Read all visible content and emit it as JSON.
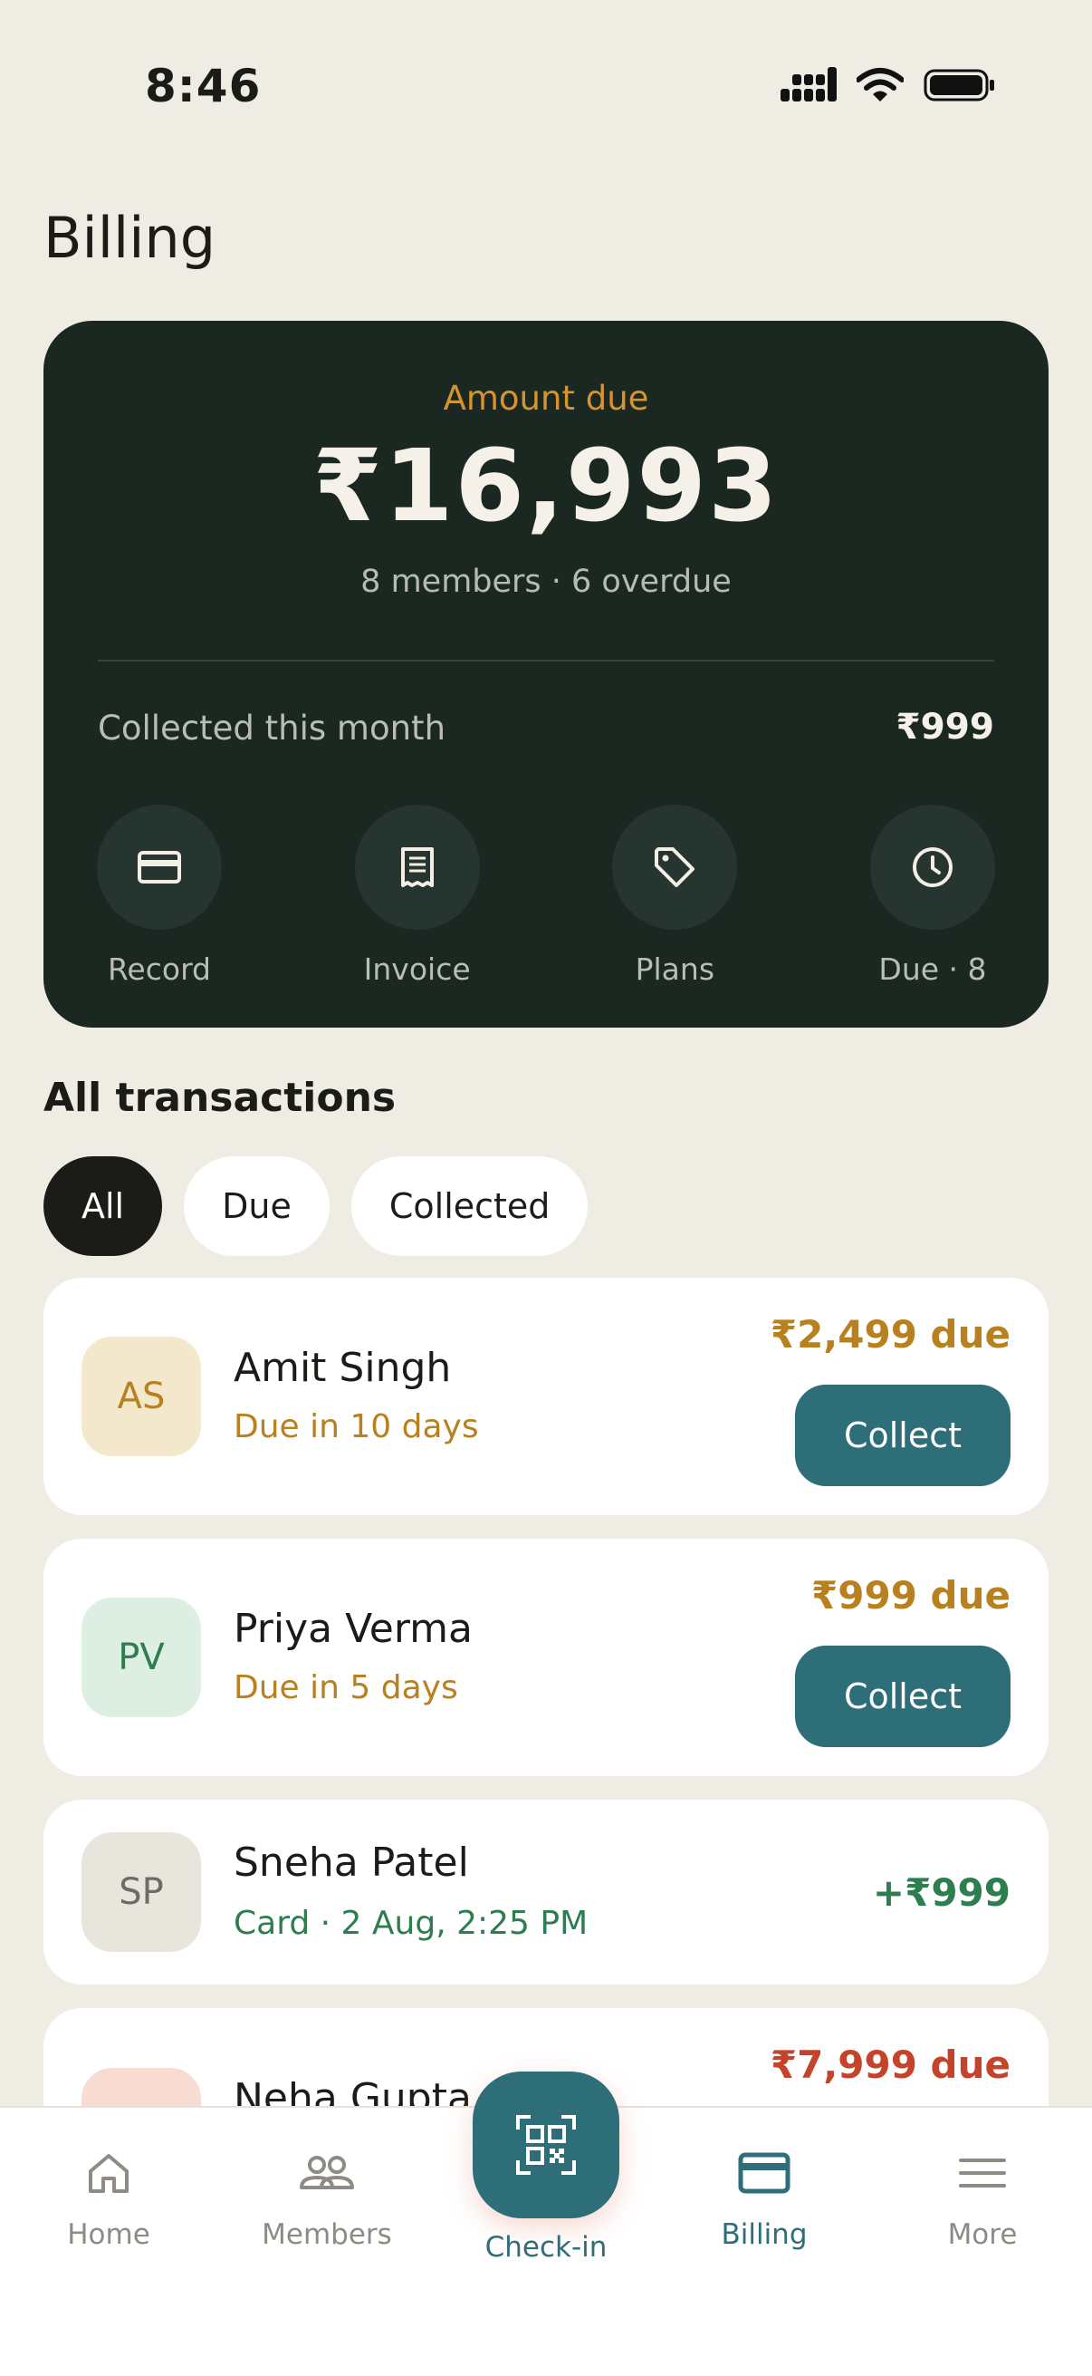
{
  "status_bar": {
    "time": "8:46"
  },
  "page_title": "Billing",
  "summary": {
    "amount_label": "Amount due",
    "amount_value": "₹16,993",
    "amount_sub": "8 members · 6 overdue",
    "collected_label": "Collected this month",
    "collected_value": "₹999",
    "actions": [
      {
        "label": "Record",
        "icon": "card-icon"
      },
      {
        "label": "Invoice",
        "icon": "receipt-icon"
      },
      {
        "label": "Plans",
        "icon": "tag-icon"
      },
      {
        "label": "Due · 8",
        "icon": "clock-icon"
      }
    ]
  },
  "transactions": {
    "title": "All transactions",
    "filters": [
      "All",
      "Due",
      "Collected"
    ],
    "active_filter": "All",
    "rows": [
      {
        "initials": "AS",
        "name": "Amit Singh",
        "sub": "Due in 10 days",
        "amount": "₹2,499 due",
        "action": "Collect",
        "status": "due"
      },
      {
        "initials": "PV",
        "name": "Priya Verma",
        "sub": "Due in 5 days",
        "amount": "₹999 due",
        "action": "Collect",
        "status": "due"
      },
      {
        "initials": "SP",
        "name": "Sneha Patel",
        "sub": "Card · 2 Aug, 2:25 PM",
        "amount": "+₹999",
        "status": "collected"
      },
      {
        "initials": "",
        "name": "Neha Gupta",
        "amount": "₹7,999 due",
        "status": "overdue"
      }
    ]
  },
  "nav": {
    "items": [
      {
        "label": "Home",
        "icon": "home-icon"
      },
      {
        "label": "Members",
        "icon": "members-icon"
      },
      {
        "label": "Check-in",
        "icon": "qr-code-icon"
      },
      {
        "label": "Billing",
        "icon": "billing-card-icon"
      },
      {
        "label": "More",
        "icon": "menu-icon"
      }
    ],
    "active": "Billing"
  },
  "colors": {
    "background": "#EFECE4",
    "card_dark": "#1B2822",
    "accent_teal": "#2D6E78",
    "due_amber": "#B8801E",
    "collected_green": "#2E7D4F",
    "overdue_red": "#C4432B"
  }
}
